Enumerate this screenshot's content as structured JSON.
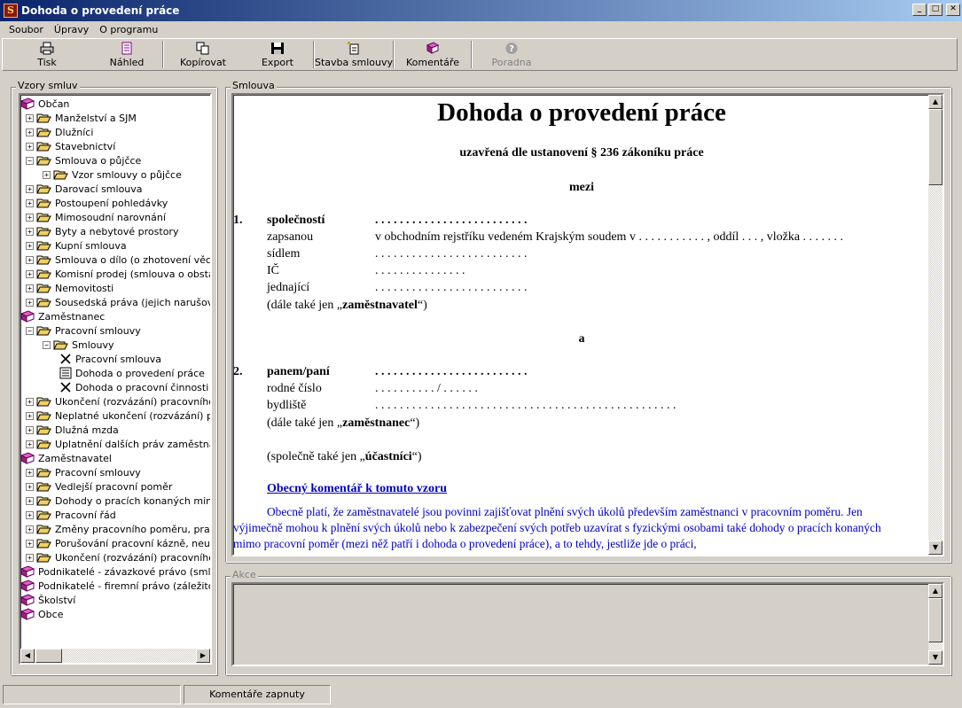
{
  "window": {
    "title": "Dohoda o provedení práce",
    "icon_letter": "S",
    "minimize": "_",
    "maximize": "□",
    "close": "✕"
  },
  "menu": [
    "Soubor",
    "Úpravy",
    "O programu"
  ],
  "toolbar": [
    {
      "label": "Tisk",
      "icon": "printer-icon"
    },
    {
      "label": "Náhled",
      "icon": "preview-icon"
    },
    {
      "label": "Kopírovat",
      "icon": "copy-icon"
    },
    {
      "label": "Export",
      "icon": "floppy-disk-icon"
    },
    {
      "label": "Stavba smlouvy",
      "icon": "new-document-icon"
    },
    {
      "label": "Komentáře",
      "icon": "book-icon"
    },
    {
      "label": "Poradna",
      "icon": "help-icon",
      "disabled": true
    }
  ],
  "left_panel": {
    "title": "Vzory smluv",
    "tree": [
      {
        "label": "Občan",
        "level": 0,
        "type": "book"
      },
      {
        "label": "Manželství a SJM",
        "level": 1,
        "type": "folder",
        "exp": "+"
      },
      {
        "label": "Dlužníci",
        "level": 1,
        "type": "folder",
        "exp": "+"
      },
      {
        "label": "Stavebnictví",
        "level": 1,
        "type": "folder",
        "exp": "+"
      },
      {
        "label": "Smlouva o půjčce",
        "level": 1,
        "type": "folder",
        "exp": "−"
      },
      {
        "label": "Vzor smlouvy o půjčce",
        "level": 2,
        "type": "folder",
        "exp": "+"
      },
      {
        "label": "Darovací smlouva",
        "level": 1,
        "type": "folder",
        "exp": "+"
      },
      {
        "label": "Postoupení pohledávky",
        "level": 1,
        "type": "folder",
        "exp": "+"
      },
      {
        "label": "Mimosoudní narovnání",
        "level": 1,
        "type": "folder",
        "exp": "+"
      },
      {
        "label": "Byty a nebytové prostory",
        "level": 1,
        "type": "folder",
        "exp": "+"
      },
      {
        "label": "Kupní smlouva",
        "level": 1,
        "type": "folder",
        "exp": "+"
      },
      {
        "label": "Smlouva o dílo (o zhotovení věci neb",
        "level": 1,
        "type": "folder",
        "exp": "+"
      },
      {
        "label": "Komisní prodej (smlouva o obstarání p",
        "level": 1,
        "type": "folder",
        "exp": "+"
      },
      {
        "label": "Nemovitosti",
        "level": 1,
        "type": "folder",
        "exp": "+"
      },
      {
        "label": "Sousedská práva (jejich narušování)",
        "level": 1,
        "type": "folder",
        "exp": "+"
      },
      {
        "label": "Zaměstnanec",
        "level": 0,
        "type": "book"
      },
      {
        "label": "Pracovní smlouvy",
        "level": 1,
        "type": "folder",
        "exp": "−"
      },
      {
        "label": "Smlouvy",
        "level": 2,
        "type": "folder",
        "exp": "−"
      },
      {
        "label": "Pracovní smlouva",
        "level": 3,
        "type": "cross"
      },
      {
        "label": "Dohoda o provedení práce",
        "level": 3,
        "type": "doc"
      },
      {
        "label": "Dohoda o pracovní činnosti",
        "level": 3,
        "type": "cross"
      },
      {
        "label": "Ukončení (rozvázání) pracovního po",
        "level": 1,
        "type": "folder",
        "exp": "+"
      },
      {
        "label": "Neplatné ukončení (rozvázání) pracc",
        "level": 1,
        "type": "folder",
        "exp": "+"
      },
      {
        "label": "Dlužná mzda",
        "level": 1,
        "type": "folder",
        "exp": "+"
      },
      {
        "label": "Uplatnění dalších práv zaměstnance",
        "level": 1,
        "type": "folder",
        "exp": "+"
      },
      {
        "label": "Zaměstnavatel",
        "level": 0,
        "type": "book"
      },
      {
        "label": "Pracovní smlouvy",
        "level": 1,
        "type": "folder",
        "exp": "+"
      },
      {
        "label": "Vedlejší pracovní poměr",
        "level": 1,
        "type": "folder",
        "exp": "+"
      },
      {
        "label": "Dohody o pracích konaných mimo pr",
        "level": 1,
        "type": "folder",
        "exp": "+"
      },
      {
        "label": "Pracovní řád",
        "level": 1,
        "type": "folder",
        "exp": "+"
      },
      {
        "label": "Změny pracovního poměru, pracovní",
        "level": 1,
        "type": "folder",
        "exp": "+"
      },
      {
        "label": "Porušování pracovní kázně, neuspol",
        "level": 1,
        "type": "folder",
        "exp": "+"
      },
      {
        "label": "Ukončení (rozvázání) pracovního po",
        "level": 1,
        "type": "folder",
        "exp": "+"
      },
      {
        "label": "Podnikatelé - závazkové právo (smlouvy",
        "level": 0,
        "type": "book"
      },
      {
        "label": "Podnikatelé - firemní právo (záležitosti sp",
        "level": 0,
        "type": "book"
      },
      {
        "label": "Školství",
        "level": 0,
        "type": "book"
      },
      {
        "label": "Obce",
        "level": 0,
        "type": "book"
      }
    ]
  },
  "contract_panel": {
    "title": "Smlouva",
    "doc": {
      "heading": "Dohoda o provedení práce",
      "subheading": "uzavřená dle ustanovení § 236 zákoníku práce",
      "between": "mezi",
      "party1_num": "1.",
      "party1_label": "společností",
      "party1_dots": ". . . . . . . . . . . . . . . . . . . . . . . . .",
      "zapsanou_label": "zapsanou",
      "zapsanou_text": "v obchodním rejstříku vedeném Krajským soudem v . . . . . . . . . . . , oddíl . . . , vložka . . . . . . .",
      "sidlem_label": "sídlem",
      "sidlem_dots": ". . . . . . . . . . . . . . . . . . . . . . . . .",
      "ic_label": "IČ",
      "ic_dots": ". . . . . . . . . . . . . . .",
      "jednajici_label": "jednající",
      "jednajici_dots": ". . . . . . . . . . . . . . . . . . . . . . . . .",
      "employer_pre": "(dále také jen „",
      "employer_bold": "zaměstnavatel",
      "employer_post": "“)",
      "and": "a",
      "party2_num": "2.",
      "party2_label": "panem/paní",
      "party2_dots": ". . . . . . . . . . . . . . . . . . . . . . . . .",
      "rc_label": "rodné číslo",
      "rc_dots": ". . . . . . . . . . / . . . . . .",
      "bydliste_label": "bydliště",
      "bydliste_dots": ". . . . . . . . . . . . . . . . . . . . . . . . . . . . . . . . . . . . . . . . . . . . . . . . .",
      "employee_pre": "(dále také jen „",
      "employee_bold": "zaměstnanec",
      "employee_post": "“)",
      "parties_pre": "(společně také jen „",
      "parties_bold": "účastníci",
      "parties_post": "“)",
      "comment_link": "Obecný komentář k tomuto vzoru",
      "comment_line1": "Obecně platí, že zaměstnavatelé jsou povinni zajišťovat plnění svých úkolů především zaměstnanci v pracovním poměru. Jen",
      "comment_line2": "výjimečně mohou k plnění svých úkolů nebo k zabezpečení svých potřeb uzavírat s fyzickými osobami také dohody o pracích konaných",
      "comment_line3": "mimo pracovní poměr (mezi něž patří i dohoda o provedení práce), a to tehdy, jestliže jde o práci,"
    }
  },
  "actions_panel": {
    "title": "Akce"
  },
  "statusbar": {
    "panel1": "",
    "panel2": "Komentáře zapnuty"
  },
  "colors": {
    "comment_blue": "#0000c0",
    "title_blue": "#0a246a"
  }
}
